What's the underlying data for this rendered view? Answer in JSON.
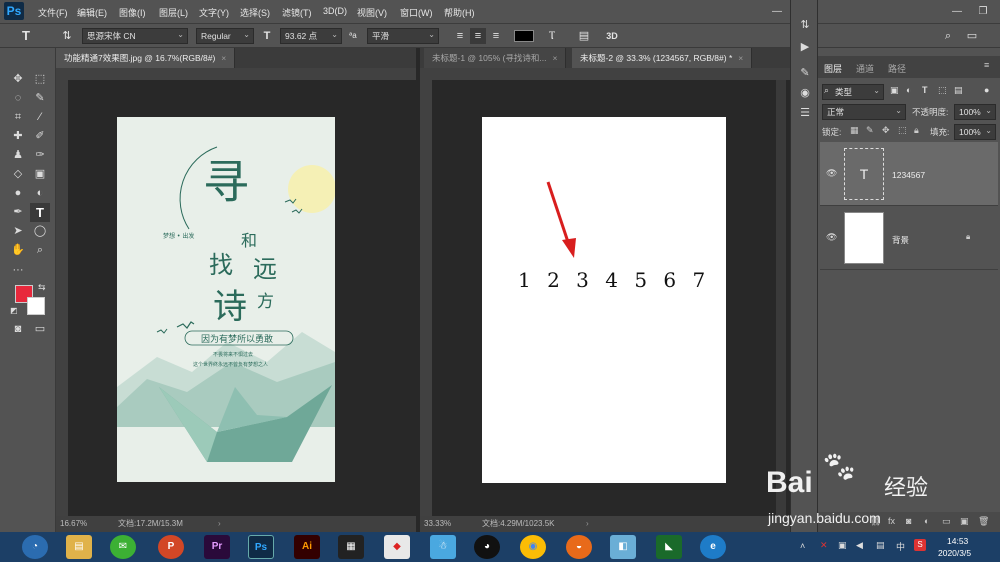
{
  "app": {
    "logo": "Ps"
  },
  "menu": [
    "文件(F)",
    "编辑(E)",
    "图像(I)",
    "图层(L)",
    "文字(Y)",
    "选择(S)",
    "滤镜(T)",
    "3D(D)",
    "视图(V)",
    "窗口(W)",
    "帮助(H)"
  ],
  "options": {
    "font_family": "思源宋体 CN",
    "font_style": "Regular",
    "font_size": "93.62 点",
    "antialias_label": "ªa",
    "antialias": "平滑",
    "three_d": "3D"
  },
  "tabs_left": [
    {
      "label": "功能精通7效果图.jpg @ 16.7%(RGB/8#)",
      "active": true
    }
  ],
  "tabs_right": [
    {
      "label": "未标题-1 @ 105% (寻找诗和...",
      "active": false
    },
    {
      "label": "未标题-2 @ 33.3% (1234567, RGB/8#) *",
      "active": true
    }
  ],
  "poster": {
    "char_xun": "寻",
    "char_zhao": "找",
    "char_he": "和",
    "char_yuan": "远",
    "char_shi": "诗",
    "char_fang": "方",
    "small_left": "梦想 • 出发",
    "slogan": "因为有梦所以勇敢",
    "line1": "不畏将来不惧过去",
    "line2": "这个世界终永远不曾负有梦想之人"
  },
  "canvas_text": "1234567",
  "status_left": {
    "zoom": "16.67%",
    "doc": "文档:17.2M/15.3M"
  },
  "status_right": {
    "zoom": "33.33%",
    "doc": "文档:4.29M/1023.5K"
  },
  "panel": {
    "tabs": [
      "图层",
      "通道",
      "路径"
    ],
    "filter_label": "类型",
    "blend_mode": "正常",
    "opacity_label": "不透明度:",
    "opacity": "100%",
    "lock_label": "锁定:",
    "fill_label": "填充:",
    "fill": "100%",
    "layers": [
      {
        "name": "1234567",
        "type": "text",
        "selected": true
      },
      {
        "name": "背景",
        "type": "background",
        "selected": false
      }
    ]
  },
  "taskbar": {
    "time": "14:53",
    "date": "2020/3/5",
    "apps": [
      "Pr",
      "Ps",
      "Ai"
    ]
  },
  "watermark": {
    "brand": "Bai",
    "brand2": "经验",
    "url": "jingyan.baidu.com"
  },
  "colors": {
    "accent": "#31a8ff",
    "foreground": "#e8283c",
    "arrow": "#d81e1e"
  }
}
